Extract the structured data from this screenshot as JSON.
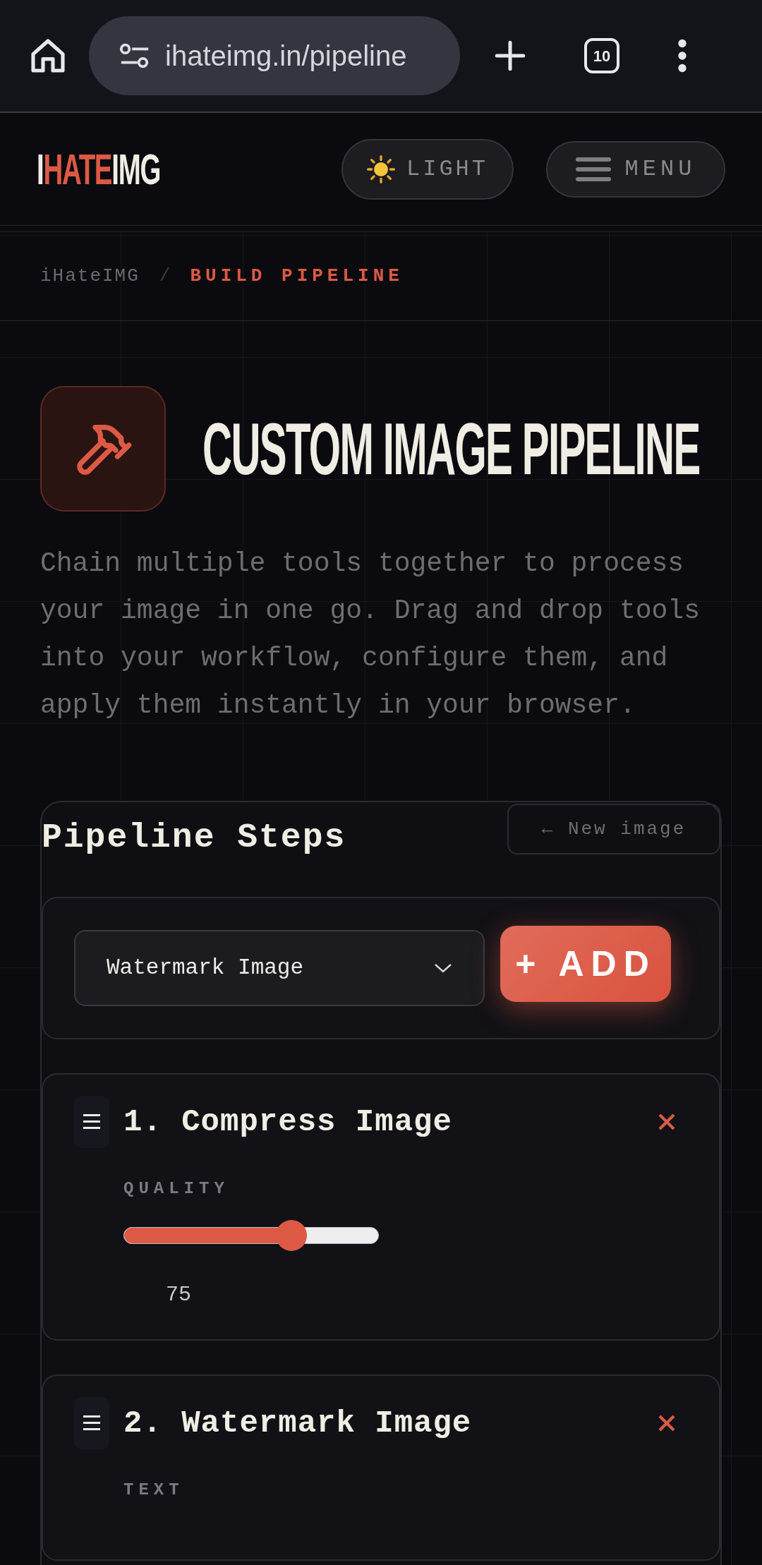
{
  "browser": {
    "url": "ihateimg.in/pipeline",
    "tab_count": "10"
  },
  "header": {
    "logo": [
      {
        "text": "I",
        "accent": false
      },
      {
        "text": "HATE",
        "accent": true
      },
      {
        "text": "IMG",
        "accent": false
      }
    ],
    "theme_button": "LIGHT",
    "menu_button": "MENU"
  },
  "breadcrumb": [
    {
      "label": "iHateIMG",
      "current": false
    },
    {
      "label": "BUILD PIPELINE",
      "current": true
    }
  ],
  "breadcrumb_separator": "/",
  "hero": {
    "title": "CUSTOM IMAGE PIPELINE",
    "description": "Chain multiple tools together to process your image in one go. Drag and drop tools into your workflow, configure them, and apply them instantly in your browser."
  },
  "pipeline": {
    "title": "Pipeline Steps",
    "new_image_button": "← New image",
    "tool_select": "Watermark Image",
    "add_button": "+ ADD",
    "steps": [
      {
        "title": "1. Compress Image",
        "fields": [
          {
            "kind": "slider",
            "label": "QUALITY",
            "level": 0.68,
            "value": "75"
          }
        ]
      },
      {
        "title": "2. Watermark Image",
        "fields": [
          {
            "kind": "text",
            "label": "TEXT"
          }
        ]
      }
    ]
  }
}
